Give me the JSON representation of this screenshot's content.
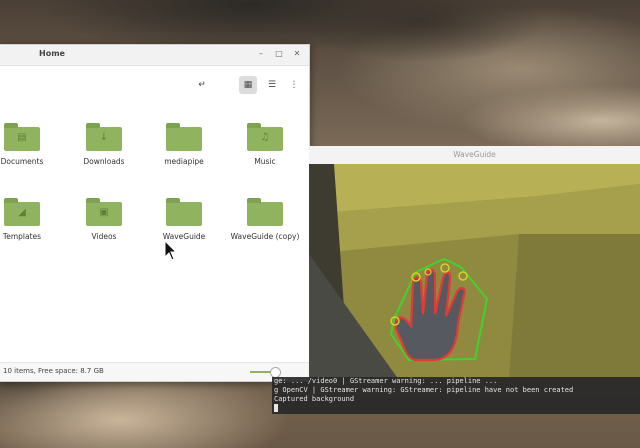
{
  "file_manager": {
    "title": "Home",
    "status": "10 items, Free space: 8.7 GB",
    "zoom_level_fraction": 0.7,
    "items": [
      {
        "label": "Documents",
        "icon": "documents-folder-icon"
      },
      {
        "label": "Downloads",
        "icon": "downloads-folder-icon"
      },
      {
        "label": "mediapipe",
        "icon": "folder-icon"
      },
      {
        "label": "Music",
        "icon": "music-folder-icon"
      },
      {
        "label": "Templates",
        "icon": "templates-folder-icon"
      },
      {
        "label": "Videos",
        "icon": "videos-folder-icon"
      },
      {
        "label": "WaveGuide",
        "icon": "folder-icon"
      },
      {
        "label": "WaveGuide (copy)",
        "icon": "folder-icon"
      }
    ],
    "toolbar": {
      "back_icon": "return-icon",
      "icon_view_icon": "grid-view-icon",
      "list_view_icon": "list-view-icon",
      "compact_view_icon": "compact-view-icon"
    },
    "colors": {
      "folder": "#8fb35f",
      "accent": "#8fb35f"
    }
  },
  "waveguide": {
    "title": "WaveGuide",
    "colors": {
      "contour": "#e53935",
      "hull": "#43d12b",
      "fingertip": "#d7d02a"
    }
  },
  "terminal": {
    "lines": [
      "ge: ... /video0 | GStreamer warning: ... pipeline ...",
      "g OpenCV | GStreamer warning: GStreamer: pipeline have not been created",
      "Captured background"
    ]
  }
}
